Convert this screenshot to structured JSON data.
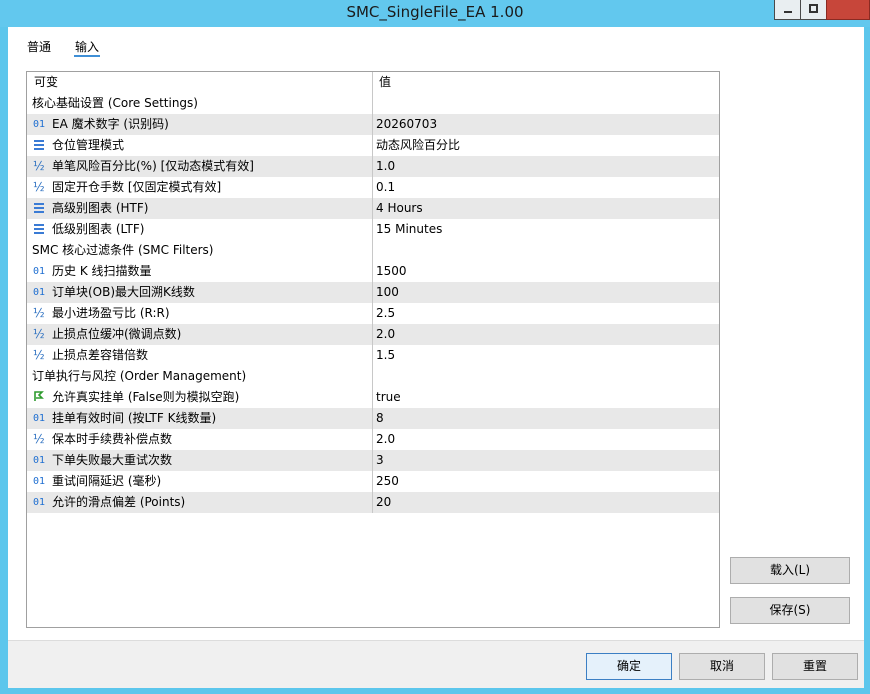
{
  "window": {
    "title": "SMC_SingleFile_EA 1.00"
  },
  "tabs": {
    "general": "普通",
    "inputs": "输入"
  },
  "grid": {
    "header_variable": "可变",
    "header_value": "值",
    "rows": [
      {
        "type": "group",
        "label": "核心基础设置 (Core Settings)",
        "value": ""
      },
      {
        "type": "int",
        "icon_text": "01",
        "label": "EA 魔术数字 (识别码)",
        "value": "20260703"
      },
      {
        "type": "enum",
        "label": "仓位管理模式",
        "value": "动态风险百分比"
      },
      {
        "type": "double",
        "icon_text": "½",
        "label": "单笔风险百分比(%) [仅动态模式有效]",
        "value": "1.0"
      },
      {
        "type": "double",
        "icon_text": "½",
        "label": "固定开仓手数 [仅固定模式有效]",
        "value": "0.1"
      },
      {
        "type": "enum",
        "label": "高级别图表 (HTF)",
        "value": "4 Hours"
      },
      {
        "type": "enum",
        "label": "低级别图表 (LTF)",
        "value": "15 Minutes"
      },
      {
        "type": "group",
        "label": "SMC 核心过滤条件 (SMC Filters)",
        "value": ""
      },
      {
        "type": "int",
        "icon_text": "01",
        "label": "历史 K 线扫描数量",
        "value": "1500"
      },
      {
        "type": "int",
        "icon_text": "01",
        "label": "订单块(OB)最大回溯K线数",
        "value": "100"
      },
      {
        "type": "double",
        "icon_text": "½",
        "label": "最小进场盈亏比 (R:R)",
        "value": "2.5"
      },
      {
        "type": "double",
        "icon_text": "½",
        "label": "止损点位缓冲(微调点数)",
        "value": "2.0"
      },
      {
        "type": "double",
        "icon_text": "½",
        "label": "止损点差容错倍数",
        "value": "1.5"
      },
      {
        "type": "group",
        "label": "订单执行与风控 (Order Management)",
        "value": ""
      },
      {
        "type": "bool",
        "label": "允许真实挂单 (False则为模拟空跑)",
        "value": "true"
      },
      {
        "type": "int",
        "icon_text": "01",
        "label": "挂单有效时间 (按LTF K线数量)",
        "value": "8"
      },
      {
        "type": "double",
        "icon_text": "½",
        "label": "保本时手续费补偿点数",
        "value": "2.0"
      },
      {
        "type": "int",
        "icon_text": "01",
        "label": "下单失败最大重试次数",
        "value": "3"
      },
      {
        "type": "int",
        "icon_text": "01",
        "label": "重试间隔延迟 (毫秒)",
        "value": "250"
      },
      {
        "type": "int",
        "icon_text": "01",
        "label": "允许的滑点偏差 (Points)",
        "value": "20"
      }
    ]
  },
  "buttons": {
    "load": "载入(L)",
    "save": "保存(S)",
    "ok": "确定",
    "cancel": "取消",
    "reset": "重置"
  },
  "colors": {
    "titlebar": "#62c8ee",
    "accent": "#3f8fd6",
    "close": "#c7463a",
    "row_alt": "#e8e8e8"
  }
}
